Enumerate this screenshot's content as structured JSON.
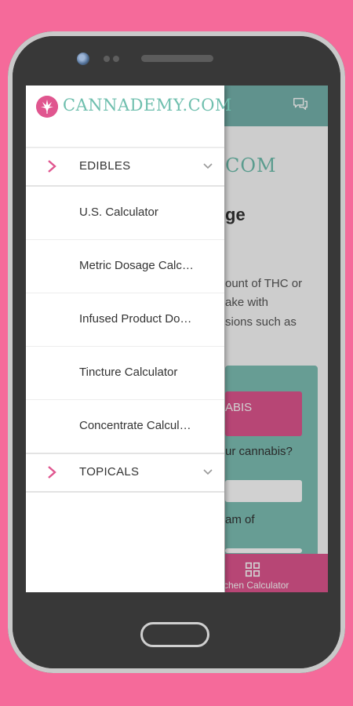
{
  "drawer": {
    "logo_text": "CANNADEMY.COM",
    "sections": [
      {
        "label": "EDIBLES",
        "items": [
          "U.S. Calculator",
          "Metric Dosage Calc…",
          "Infused Product Do…",
          "Tincture Calculator",
          "Concentrate Calcul…"
        ]
      },
      {
        "label": "TOPICALS",
        "items": []
      }
    ]
  },
  "background": {
    "logo_fragment": "COM",
    "title_fragment": "ge",
    "text_lines": [
      "ount of THC or",
      "ake with",
      "sions such as"
    ],
    "pink_button_fragment": "ABIS",
    "question_fragment": "ur cannabis?",
    "label_fragment": "am of",
    "bottom_label": "chen Calculator"
  },
  "colors": {
    "background": "#f56a9a",
    "header_teal": "#76b3ac",
    "logo_teal": "#6fbfae",
    "accent_pink": "#e0568f"
  }
}
